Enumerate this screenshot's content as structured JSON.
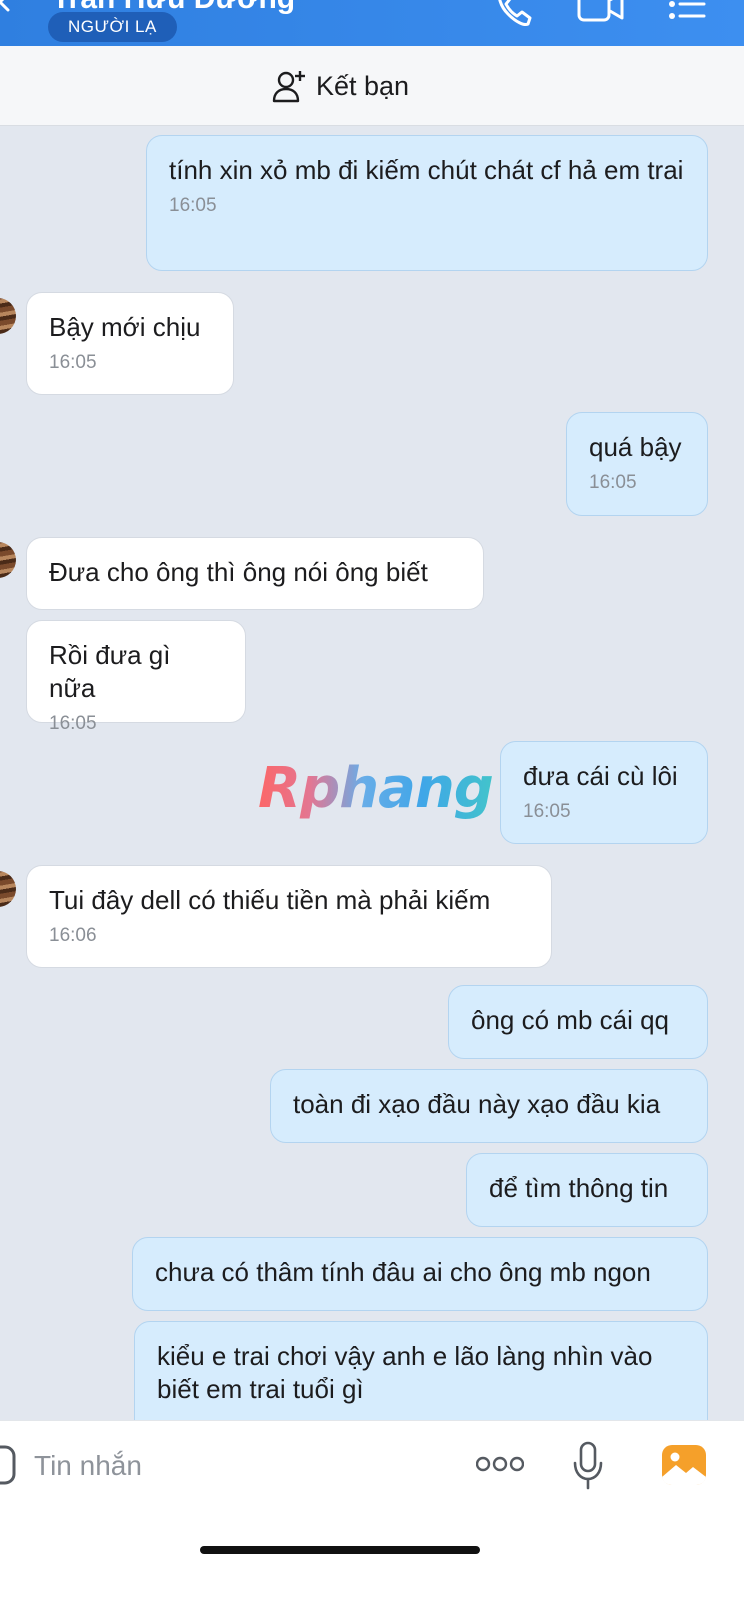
{
  "header": {
    "title": "Trần Hữu Đương",
    "badge": "NGƯỜI LẠ",
    "icons": [
      "back-arrow-icon",
      "phone-icon",
      "video-call-icon",
      "menu-list-icon"
    ],
    "background": "#2f7fe0"
  },
  "add_friend": {
    "label": "Kết bạn",
    "icon": "add-person-icon"
  },
  "messages": [
    {
      "direction": "out",
      "text": "tính xin xỏ mb đi kiếm chút chát cf hả em trai",
      "time": "16:05"
    },
    {
      "direction": "in",
      "text": "Bậy mới chịu",
      "time": "16:05"
    },
    {
      "direction": "out",
      "text": "quá bậy",
      "time": "16:05"
    },
    {
      "direction": "in",
      "text": "Đưa cho ông thì ông nói ông biết",
      "time": ""
    },
    {
      "direction": "in",
      "text": "Rồi đưa gì nữa",
      "time": "16:05"
    },
    {
      "direction": "out",
      "text": "đưa cái cù lôi",
      "time": "16:05"
    },
    {
      "direction": "in",
      "text": "Tui đây dell có thiếu tiền mà phải kiếm",
      "time": "16:06"
    },
    {
      "direction": "out",
      "text": "ông có mb cái qq",
      "time": ""
    },
    {
      "direction": "out",
      "text": "toàn đi xạo đầu này xạo đầu kia",
      "time": ""
    },
    {
      "direction": "out",
      "text": "để tìm thông tin",
      "time": ""
    },
    {
      "direction": "out",
      "text": "chưa có thâm tính đâu ai cho ông mb ngon",
      "time": ""
    },
    {
      "direction": "out",
      "text": "kiểu e trai chơi vậy anh e lão làng nhìn vào biết em trai tuổi gì",
      "time": ""
    }
  ],
  "watermark": "Rphang",
  "composer": {
    "placeholder": "Tin nhắn",
    "icons": [
      "sticker-icon",
      "more-options-icon",
      "microphone-icon",
      "image-gallery-icon"
    ]
  },
  "colors": {
    "outgoing_bubble": "#d6ecfd",
    "incoming_bubble": "#ffffff",
    "chat_background": "#e2e7ef",
    "image_icon": "#f5a02a"
  }
}
